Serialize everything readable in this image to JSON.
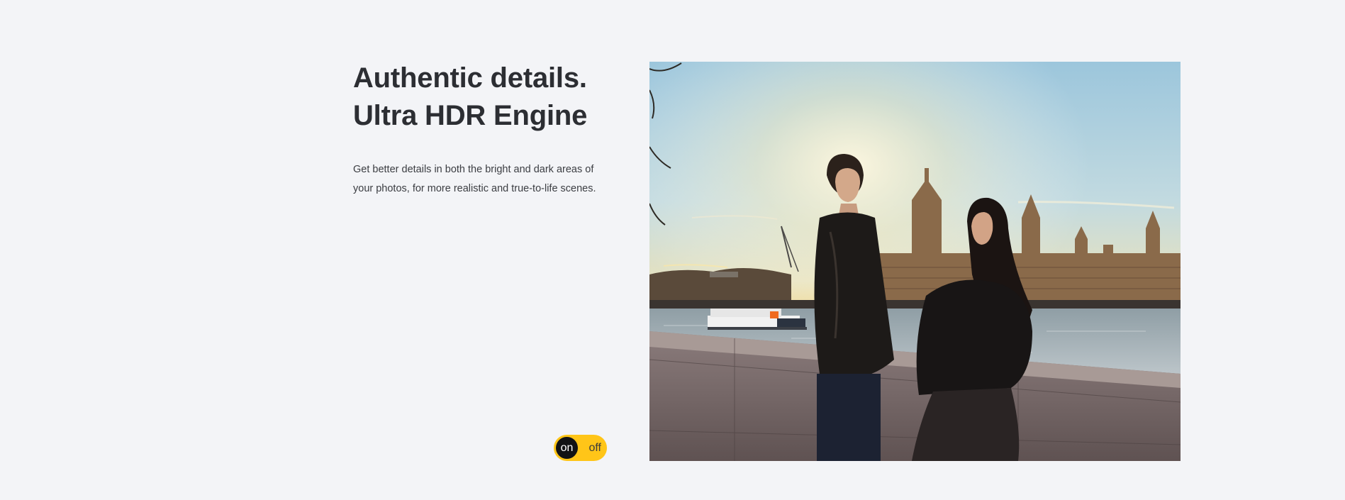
{
  "feature": {
    "title_line1": "Authentic details.",
    "title_line2": "Ultra HDR Engine",
    "description": "Get better details in both the bright and dark areas of your photos, for more realistic and true-to-life scenes."
  },
  "hdr_toggle": {
    "on_label": "on",
    "off_label": "off",
    "state": "on",
    "accent_color": "#ffc518",
    "knob_color": "#111214"
  },
  "photo": {
    "subject": "couple-by-river-with-parliament-at-sunset"
  }
}
